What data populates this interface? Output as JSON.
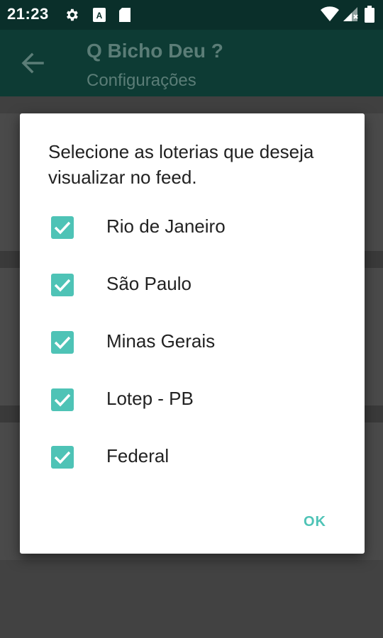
{
  "status_bar": {
    "time": "21:23",
    "icons": [
      "gear-icon",
      "a-icon",
      "sd-card-icon",
      "wifi-icon",
      "signal-icon",
      "battery-icon"
    ]
  },
  "app_bar": {
    "title": "Q Bicho Deu ?",
    "subtitle": "Configurações",
    "back_icon": "arrow-back-icon"
  },
  "dialog": {
    "message": "Selecione as loterias que deseja visualizar no feed.",
    "options": [
      {
        "label": "Rio de Janeiro",
        "checked": true
      },
      {
        "label": "São Paulo",
        "checked": true
      },
      {
        "label": "Minas Gerais",
        "checked": true
      },
      {
        "label": "Lotep - PB",
        "checked": true
      },
      {
        "label": "Federal",
        "checked": true
      }
    ],
    "ok_label": "OK"
  },
  "colors": {
    "accent": "#4ec3b6",
    "app_bar": "#0d3b34",
    "status_bar": "#0a2f2a"
  }
}
